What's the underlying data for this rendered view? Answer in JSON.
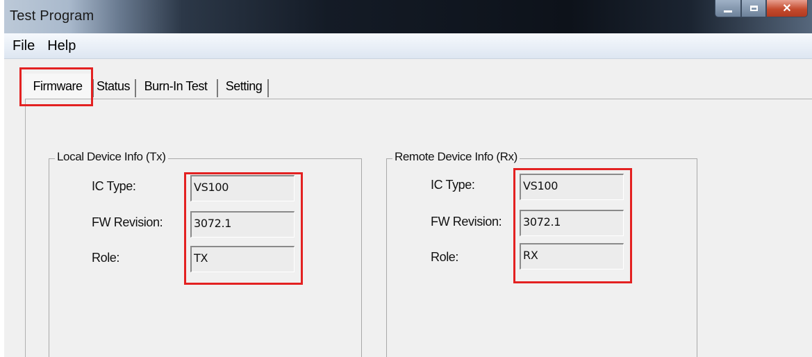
{
  "window": {
    "title": "Test Program"
  },
  "menu": {
    "items": [
      "File",
      "Help"
    ]
  },
  "tabs": [
    "Firmware",
    "Status",
    "Burn-In Test",
    "Setting"
  ],
  "active_tab": "Firmware",
  "local": {
    "title": "Local Device Info (Tx)",
    "fields": [
      {
        "label": "IC Type:",
        "value": "VS100"
      },
      {
        "label": "FW Revision:",
        "value": "3072.1"
      },
      {
        "label": "Role:",
        "value": "TX"
      }
    ]
  },
  "remote": {
    "title": "Remote Device Info (Rx)",
    "fields": [
      {
        "label": "IC Type:",
        "value": "VS100"
      },
      {
        "label": "FW Revision:",
        "value": "3072.1"
      },
      {
        "label": "Role:",
        "value": "RX"
      }
    ]
  },
  "icons": {
    "minimize": "minimize-icon",
    "maximize": "maximize-icon",
    "close": "close-icon"
  },
  "colors": {
    "highlight": "#e32121",
    "close_button": "#c44b2e"
  }
}
